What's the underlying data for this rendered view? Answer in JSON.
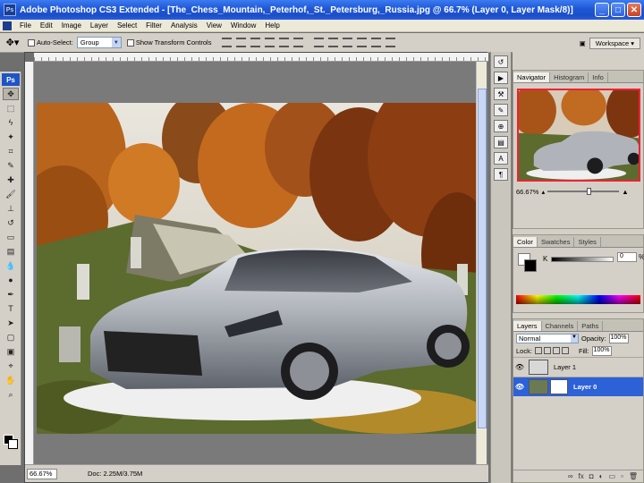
{
  "window": {
    "title": "Adobe Photoshop CS3 Extended - [The_Chess_Mountain,_Peterhof,_St._Petersburg,_Russia.jpg @ 66.7% (Layer 0, Layer Mask/8)]",
    "app_icon": "Ps",
    "controls": [
      "_",
      "□",
      "✕"
    ]
  },
  "menu": {
    "items": [
      "File",
      "Edit",
      "Image",
      "Layer",
      "Select",
      "Filter",
      "Analysis",
      "View",
      "Window",
      "Help"
    ]
  },
  "options": {
    "auto_select_label": "Auto-Select:",
    "auto_select_value": "Group",
    "show_transform_label": "Show Transform Controls",
    "workspace_label": "Workspace"
  },
  "toolbox": {
    "logo": "Ps",
    "tools": [
      {
        "name": "move-tool-icon",
        "glyph": "✥"
      },
      {
        "name": "marquee-tool-icon",
        "glyph": "⬚"
      },
      {
        "name": "lasso-tool-icon",
        "glyph": "ϟ"
      },
      {
        "name": "magic-wand-tool-icon",
        "glyph": "✦"
      },
      {
        "name": "crop-tool-icon",
        "glyph": "⌗"
      },
      {
        "name": "slice-tool-icon",
        "glyph": "✎"
      },
      {
        "name": "healing-brush-tool-icon",
        "glyph": "✚"
      },
      {
        "name": "brush-tool-icon",
        "glyph": "🖌"
      },
      {
        "name": "clone-stamp-tool-icon",
        "glyph": "⊥"
      },
      {
        "name": "history-brush-tool-icon",
        "glyph": "↺"
      },
      {
        "name": "eraser-tool-icon",
        "glyph": "▭"
      },
      {
        "name": "gradient-tool-icon",
        "glyph": "▤"
      },
      {
        "name": "blur-tool-icon",
        "glyph": "💧"
      },
      {
        "name": "dodge-tool-icon",
        "glyph": "●"
      },
      {
        "name": "pen-tool-icon",
        "glyph": "✒"
      },
      {
        "name": "type-tool-icon",
        "glyph": "T"
      },
      {
        "name": "path-selection-tool-icon",
        "glyph": "➤"
      },
      {
        "name": "shape-tool-icon",
        "glyph": "▢"
      },
      {
        "name": "notes-tool-icon",
        "glyph": "▣"
      },
      {
        "name": "eyedropper-tool-icon",
        "glyph": "⌖"
      },
      {
        "name": "hand-tool-icon",
        "glyph": "✋"
      },
      {
        "name": "zoom-tool-icon",
        "glyph": "⌕"
      }
    ]
  },
  "status": {
    "zoom": "66.67%",
    "doc_size": "Doc: 2.25M/3.75M"
  },
  "navigator": {
    "tabs": [
      "Navigator",
      "Histogram",
      "Info"
    ],
    "zoom": "66.67%"
  },
  "color_panel": {
    "tabs": [
      "Color",
      "Swatches",
      "Styles"
    ],
    "channel_label": "K",
    "value": "0",
    "unit": "%"
  },
  "layers_panel": {
    "tabs": [
      "Layers",
      "Channels",
      "Paths"
    ],
    "blend_mode": "Normal",
    "opacity_label": "Opacity:",
    "opacity": "100%",
    "lock_label": "Lock:",
    "fill_label": "Fill:",
    "fill": "100%",
    "layers": [
      {
        "name": "Layer 1",
        "selected": false
      },
      {
        "name": "Layer 0",
        "selected": true
      }
    ]
  }
}
